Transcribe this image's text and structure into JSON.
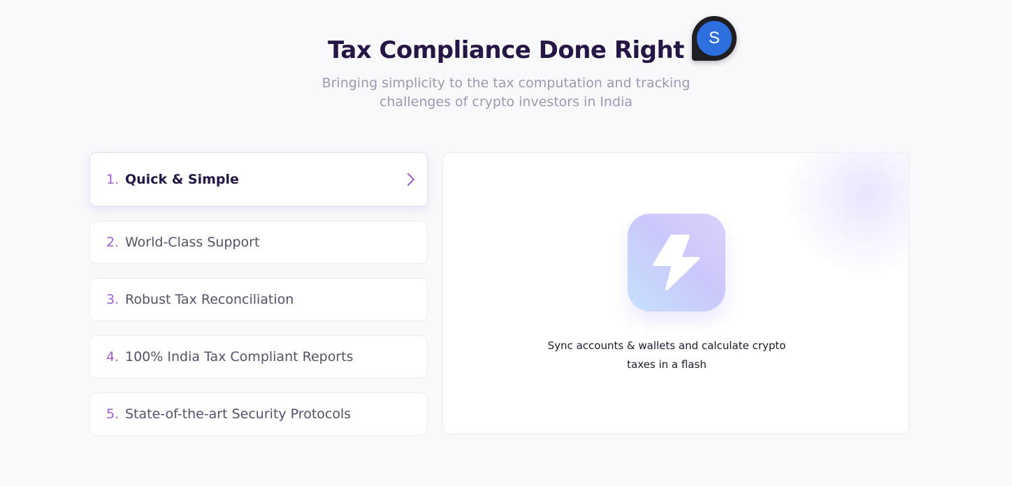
{
  "header": {
    "title": "Tax Compliance Done Right",
    "subtitle": "Bringing simplicity to the tax computation and tracking challenges of crypto investors in India"
  },
  "avatar": {
    "initial": "S",
    "color": "#2e6fe0"
  },
  "features": [
    {
      "number": "1.",
      "label": "Quick & Simple",
      "active": true
    },
    {
      "number": "2.",
      "label": "World-Class Support",
      "active": false
    },
    {
      "number": "3.",
      "label": "Robust Tax Reconciliation",
      "active": false
    },
    {
      "number": "4.",
      "label": "100% India Tax Compliant Reports",
      "active": false
    },
    {
      "number": "5.",
      "label": "State-of-the-art Security Protocols",
      "active": false
    }
  ],
  "detail": {
    "icon": "lightning-bolt-icon",
    "description": "Sync accounts & wallets and calculate crypto taxes in a flash"
  },
  "colors": {
    "accent": "#9d5ed6",
    "title": "#261646",
    "subtitle": "#9a98b3"
  }
}
